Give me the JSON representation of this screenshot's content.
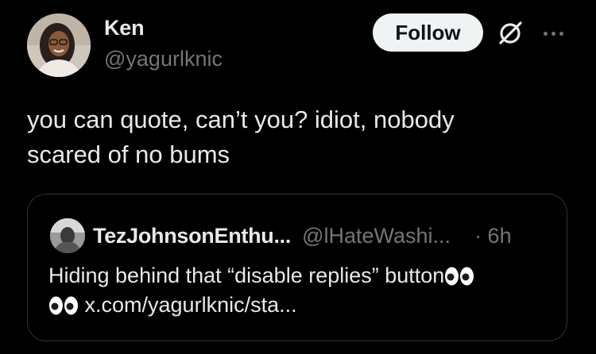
{
  "author": {
    "display_name": "Ken",
    "handle": "@yagurlknic"
  },
  "actions": {
    "follow_label": "Follow",
    "grok_icon": "grok-slash-icon",
    "more_icon": "more-dots-icon"
  },
  "tweet": {
    "text": "you can quote, can’t you? idiot, nobody\nscared of no bums"
  },
  "quote": {
    "display_name": "TezJohnsonEnthu...",
    "handle": "@lHateWashi...",
    "time": "· 6h",
    "line1": "Hiding behind that “disable replies” button",
    "link": "x.com/yagurlknic/sta..."
  },
  "colors": {
    "background": "#000000",
    "primary_text": "#e7e9ea",
    "secondary_text": "#71767b",
    "follow_button_bg": "#eff3f4",
    "card_border": "#2f3336"
  }
}
